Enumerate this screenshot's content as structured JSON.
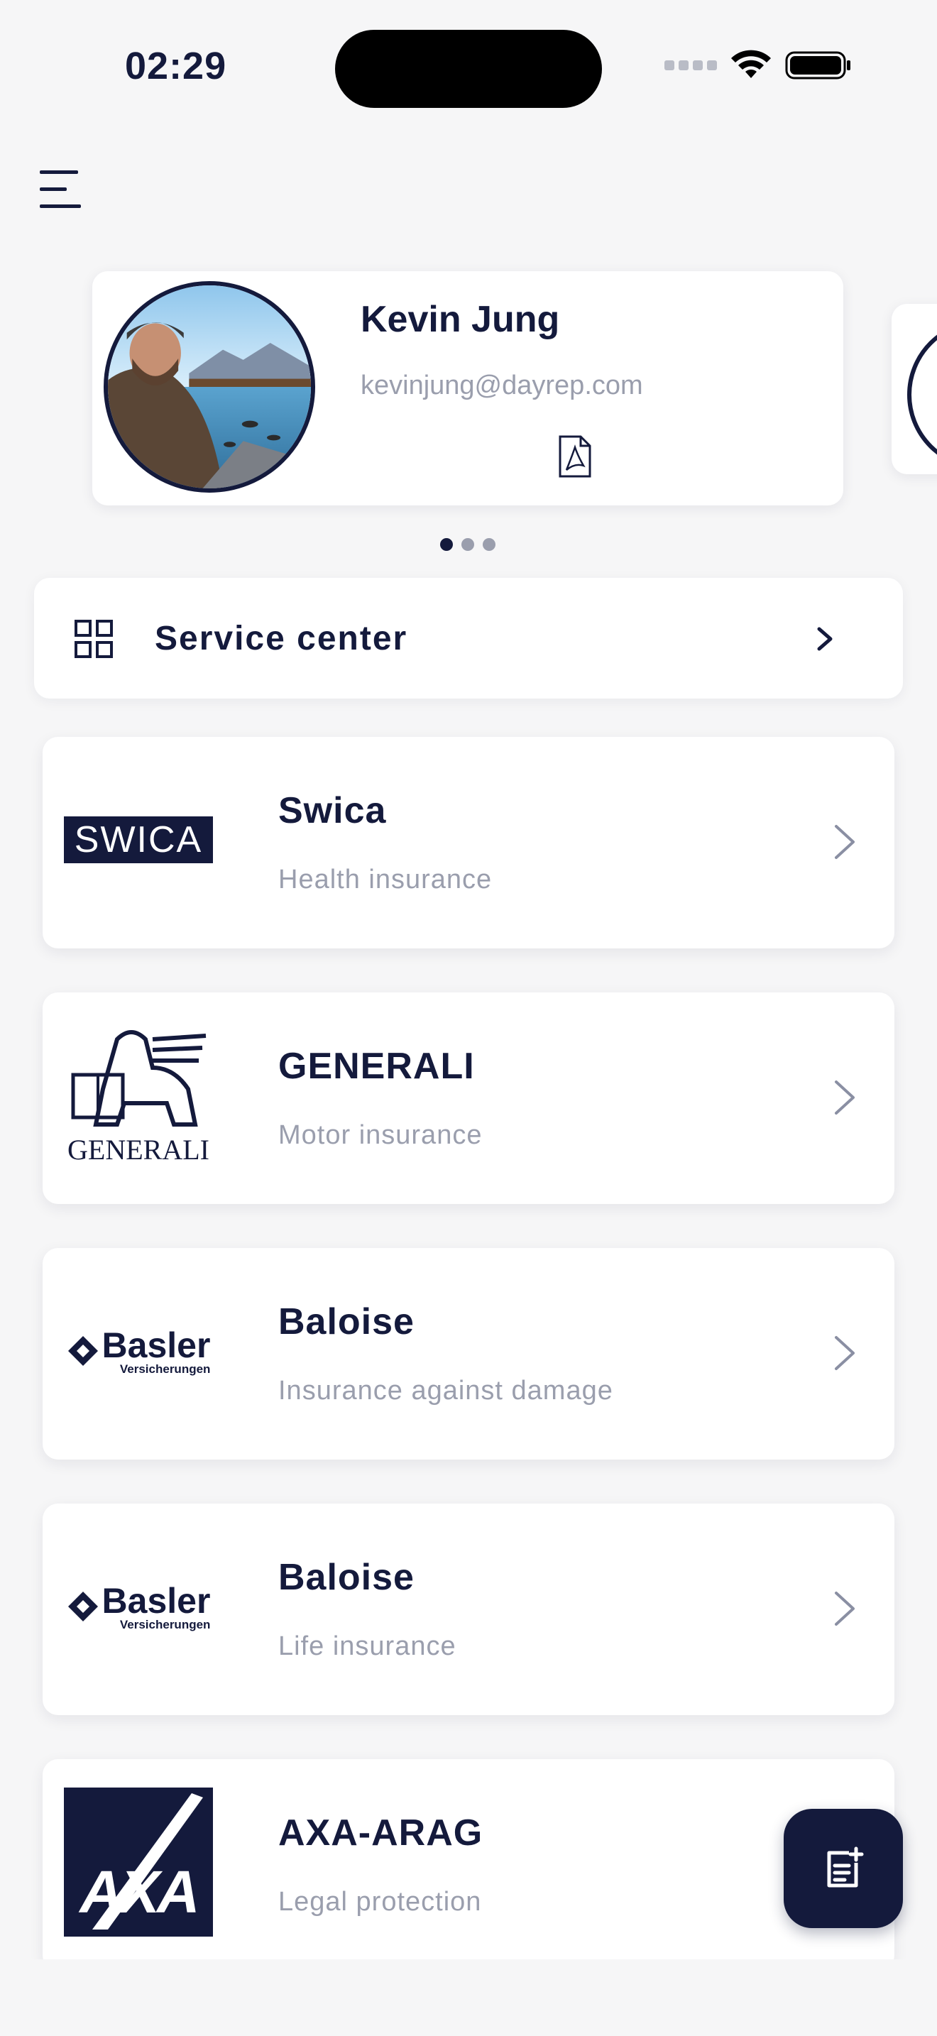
{
  "status_bar": {
    "time": "02:29"
  },
  "profile": {
    "name": "Kevin Jung",
    "email": "kevinjung@dayrep.com",
    "avatar_icon": "person-photo",
    "document_icon": "pdf-icon",
    "pager": {
      "count": 3,
      "active": 0
    }
  },
  "service_center": {
    "label": "Service center",
    "icon": "grid-icon"
  },
  "insurances": [
    {
      "name": "Swica",
      "type": "Health insurance",
      "logo_text": "SWICA"
    },
    {
      "name": "GENERALI",
      "type": "Motor insurance",
      "logo_text": "GENERALI"
    },
    {
      "name": "Baloise",
      "type": "Insurance against damage",
      "logo_text": "Basler",
      "logo_sub": "Versicherungen"
    },
    {
      "name": "Baloise",
      "type": "Life insurance",
      "logo_text": "Basler",
      "logo_sub": "Versicherungen"
    },
    {
      "name": "AXA-ARAG",
      "type": "Legal protection",
      "logo_text": "AXA"
    }
  ],
  "colors": {
    "primary": "#141a3c",
    "muted": "#9a9ead",
    "background": "#f6f6f7",
    "card": "#ffffff"
  },
  "fab": {
    "icon": "note-add-icon"
  }
}
